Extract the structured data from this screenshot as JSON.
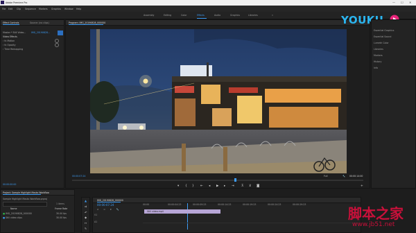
{
  "app": {
    "title": "Adobe Premiere Pro",
    "window_controls": [
      "—",
      "☐",
      "✕"
    ]
  },
  "menubar": [
    "File",
    "Edit",
    "Clip",
    "Sequence",
    "Markers",
    "Graphics",
    "Window",
    "Help"
  ],
  "workspaces": {
    "items": [
      "Assembly",
      "Editing",
      "Color",
      "Effects",
      "Audio",
      "Graphics",
      "Libraries"
    ],
    "active_index": 3,
    "overflow": "»"
  },
  "effect_controls": {
    "tabs": [
      "Effect Controls",
      "Source: (no clips)"
    ],
    "source_label": "Master * Still Video...",
    "clip_label": "IMG_20190828...",
    "section": "Video Effects",
    "rows": [
      "Motion",
      "Opacity",
      "Time Remapping"
    ],
    "timecode": "00:00:00:00"
  },
  "program": {
    "title": "Program: IMG_20190828_000000",
    "timecode_left": "00:00:07:24",
    "timecode_right": "00:00:14:00",
    "zoom": "Fit",
    "quality": "Full"
  },
  "logo": {
    "text": "YOUKU"
  },
  "right_panel": {
    "items": [
      "Essential Graphics",
      "Essential Sound",
      "Lumetri Color",
      "Libraries",
      "Markers",
      "History",
      "Info"
    ]
  },
  "project": {
    "title": "Project: Sample Highlight Masks Workflow",
    "path": "Sample Highlight Masks Workflow.prproj",
    "count": "1 items",
    "columns": [
      "Name",
      "Frame Rate"
    ],
    "items": [
      {
        "name": "IMG_20190828_000000",
        "fps": "30.00 fps"
      },
      {
        "name": "Still video clips",
        "fps": "30.00 fps"
      }
    ]
  },
  "timeline": {
    "title": "IMG_20190828_000000",
    "timecode": "00:00:07:24",
    "ruler": [
      "00:00",
      "00:00:04:23",
      "00:00:09:23",
      "00:00:14:23",
      "00:00:19:23",
      "00:00:24:23",
      "00:00:29:23"
    ],
    "clip_label": "Still video.mp4",
    "tracks": [
      "V1",
      "A1"
    ]
  },
  "watermark": {
    "line1": "脚本之家",
    "line2": "www.jb51.net"
  },
  "colors": {
    "accent": "#3d9df6",
    "logo_pink": "#e8247a",
    "logo_blue": "#2bb5f0",
    "watermark": "#c8103a"
  }
}
